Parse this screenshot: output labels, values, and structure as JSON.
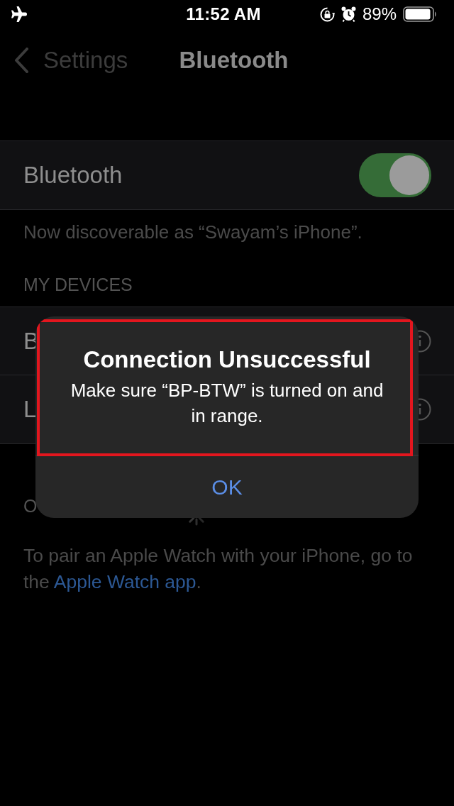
{
  "status_bar": {
    "time": "11:52 AM",
    "battery": "89%"
  },
  "nav_bar": {
    "back": "Settings",
    "title": "Bluetooth"
  },
  "bluetooth": {
    "label": "Bluetooth",
    "on": true
  },
  "discoverable_note": "Now discoverable as “Swayam’s iPhone”.",
  "my_devices": {
    "header": "MY DEVICES",
    "devices": [
      {
        "name": "B"
      },
      {
        "name": "L"
      }
    ]
  },
  "other_devices": {
    "header": "O",
    "searching": true
  },
  "watch_note": {
    "text": "To pair an Apple Watch with your iPhone, go to the ",
    "link": "Apple Watch app",
    "after": "."
  },
  "alert": {
    "title": "Connection Unsuccessful",
    "message": "Make sure “BP-BTW” is turned on and in range.",
    "highlighted": true,
    "buttons": [
      {
        "label": "OK"
      }
    ]
  }
}
